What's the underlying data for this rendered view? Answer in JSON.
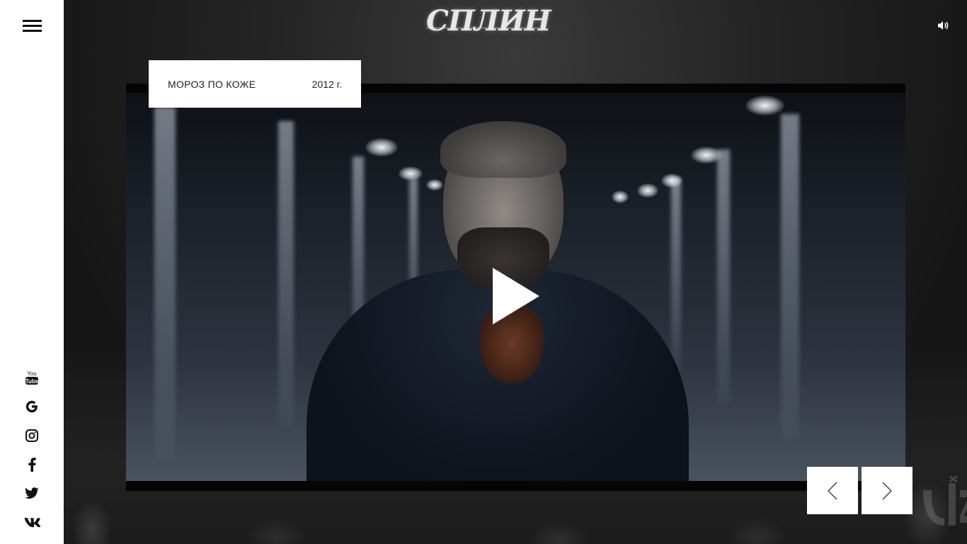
{
  "header": {
    "logo_text": "СПЛИН"
  },
  "sidebar": {
    "menu_icon": "hamburger-icon",
    "social": [
      {
        "name": "youtube-icon",
        "label": "You Tube"
      },
      {
        "name": "google-icon",
        "label": "G"
      },
      {
        "name": "instagram-icon",
        "label": ""
      },
      {
        "name": "facebook-icon",
        "label": "f"
      },
      {
        "name": "twitter-icon",
        "label": ""
      },
      {
        "name": "vk-icon",
        "label": ""
      }
    ]
  },
  "video": {
    "title": "МОРОЗ ПО КОЖЕ",
    "year": "2012 г."
  },
  "controls": {
    "sound_icon": "speaker-icon",
    "prev_icon": "chevron-left-icon",
    "next_icon": "chevron-right-icon",
    "play_icon": "play-icon"
  }
}
